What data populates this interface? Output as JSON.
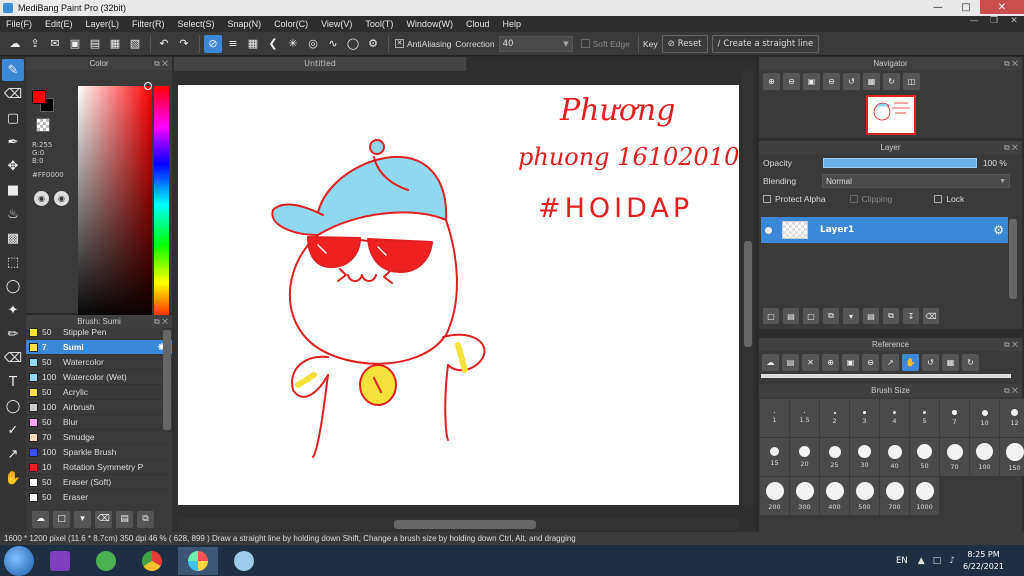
{
  "window": {
    "title": "MediBang Paint Pro (32bit)"
  },
  "menu": [
    "File(F)",
    "Edit(E)",
    "Layer(L)",
    "Filter(R)",
    "Select(S)",
    "Snap(N)",
    "Color(C)",
    "View(V)",
    "Tool(T)",
    "Window(W)",
    "Cloud",
    "Help"
  ],
  "toolbar": {
    "antialiasing_label": "AntiAliasing",
    "correction_label": "Correction",
    "correction_value": "40",
    "soft_edge_label": "Soft Edge",
    "key_label": "Key",
    "reset_label": "Reset",
    "straight_line_label": "Create a straight line"
  },
  "color_panel": {
    "title": "Color",
    "r": "R:255",
    "g": "G:0",
    "b": "B:0",
    "hex": "#FF0000",
    "foreground": "#ff0000",
    "background": "#000000"
  },
  "brush_panel": {
    "title": "Brush: Sumi",
    "items": [
      {
        "size": "50",
        "name": "Stipple Pen",
        "color": "#ffe24a"
      },
      {
        "size": "7",
        "name": "Sumi",
        "color": "#ffe24a",
        "selected": true
      },
      {
        "size": "50",
        "name": "Watercolor",
        "color": "#8fd8f0"
      },
      {
        "size": "100",
        "name": "Watercolor (Wet)",
        "color": "#8fd8f0"
      },
      {
        "size": "50",
        "name": "Acrylic",
        "color": "#ffe24a"
      },
      {
        "size": "100",
        "name": "Airbrush",
        "color": "#cccccc"
      },
      {
        "size": "50",
        "name": "Blur",
        "color": "#f5a6f0"
      },
      {
        "size": "70",
        "name": "Smudge",
        "color": "#ffd7c0"
      },
      {
        "size": "100",
        "name": "Sparkle Brush",
        "color": "#3355ee"
      },
      {
        "size": "10",
        "name": "Rotation Symmetry P",
        "color": "#ee2222"
      },
      {
        "size": "50",
        "name": "Eraser (Soft)",
        "color": "#ffffff"
      },
      {
        "size": "50",
        "name": "Eraser",
        "color": "#ffffff"
      }
    ]
  },
  "document": {
    "tab_title": "Untitled",
    "handwriting": {
      "line1": "Phương",
      "line2": "phuong 16102010",
      "line3": "#HOIDAP"
    }
  },
  "navigator": {
    "title": "Navigator"
  },
  "layer_panel": {
    "title": "Layer",
    "opacity_label": "Opacity",
    "opacity_value": "100 %",
    "opacity_fraction": 1.0,
    "blending_label": "Blending",
    "blending_value": "Normal",
    "protect_alpha": "Protect Alpha",
    "clipping": "Clipping",
    "lock": "Lock",
    "layers": [
      {
        "name": "Layer1"
      }
    ]
  },
  "reference": {
    "title": "Reference"
  },
  "brush_size": {
    "title": "Brush Size",
    "sizes": [
      "1",
      "1.5",
      "2",
      "3",
      "4",
      "5",
      "7",
      "10",
      "12",
      "15",
      "20",
      "25",
      "30",
      "40",
      "50",
      "70",
      "100",
      "150",
      "200",
      "300",
      "400",
      "500",
      "700",
      "1000"
    ]
  },
  "status": {
    "text": "1600 * 1200 pixel  (11.6 * 8.7cm)  350 dpi  46 %   ( 628, 899 )  Draw a straight line by holding down Shift, Change a brush size by holding down Ctrl, Alt, and dragging"
  },
  "taskbar": {
    "language": "EN",
    "time": "8:25 PM",
    "date": "6/22/2021"
  }
}
